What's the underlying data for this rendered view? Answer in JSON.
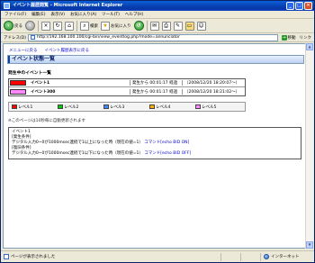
{
  "window": {
    "title": "イベント履歴閲覧 - Microsoft Internet Explorer"
  },
  "menu": [
    "ファイル(F)",
    "編集(E)",
    "表示(V)",
    "お気に入り(A)",
    "ツール(T)",
    "ヘルプ(H)"
  ],
  "toolbar": {
    "back_label": "戻る",
    "search_label": "検索",
    "favorites_label": "お気に入り"
  },
  "address": {
    "label": "アドレス(D)",
    "url": "http://192.168.100.100/cgi-bin/view_eventlog.php?mode=annunciator",
    "go_label": "移動",
    "links_label": "リンク"
  },
  "page": {
    "nav_link_1": "メニューに戻る",
    "nav_link_2": "イベント履歴表示に戻る",
    "title": "イベント状態一覧",
    "section_title": "発生中のイベント一覧",
    "events": [
      {
        "name": "イベント1",
        "elapsed": "発生から 00:01:17 経過",
        "time": "（2008/12/20 18:20:07～）",
        "color": "#ff0000"
      },
      {
        "name": "イベント300",
        "elapsed": "発生から 00:01:17 経過",
        "time": "（2008/12/20 18:21:02～）",
        "color": "#ff88ff"
      }
    ],
    "legend": [
      {
        "label": "レベル1",
        "color": "#ff0000"
      },
      {
        "label": "レベル2",
        "color": "#00cc00"
      },
      {
        "label": "レベル3",
        "color": "#4488ff"
      },
      {
        "label": "レベル4",
        "color": "#ffaa00"
      },
      {
        "label": "レベル5",
        "color": "#ff88ff"
      }
    ],
    "note": "※このページは10秒毎に自動更新されます",
    "detail_lines": [
      "イベント1",
      "[発生条件]",
      "デジタル入力0~0が1000msec連続で1以上になった時（現在の値=1）",
      "[復旧条件]",
      "デジタル入力0~0が1000msec連続で1以下になった時（現在の値=1）"
    ],
    "detail_link_1": "コマンド[echo BID ON]",
    "detail_link_2": "コマンド[echo BID OFF]"
  },
  "status": {
    "text": "ページが表示されました",
    "zone": "インターネット"
  },
  "colors": {
    "titlebar": "#0a3fb8",
    "link": "#0000cc"
  }
}
